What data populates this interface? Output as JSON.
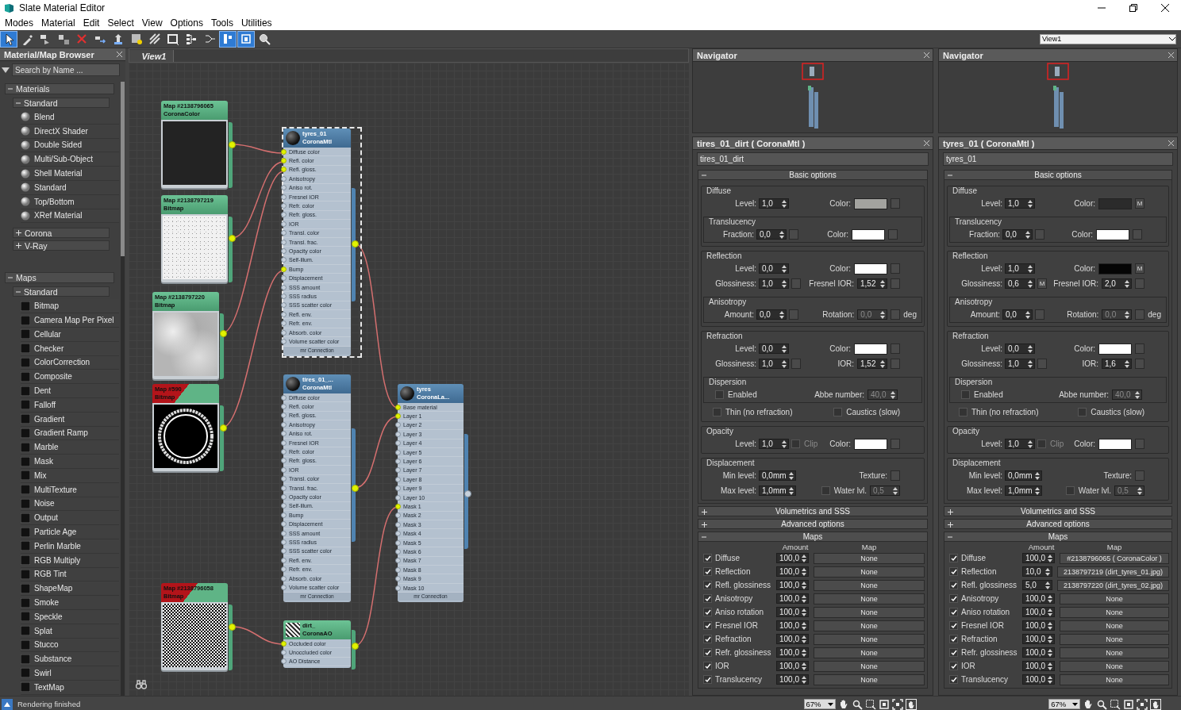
{
  "window": {
    "title": "Slate Material Editor"
  },
  "menu": [
    "Modes",
    "Material",
    "Edit",
    "Select",
    "View",
    "Options",
    "Tools",
    "Utilities"
  ],
  "toolbar": [
    {
      "kind": "pointer",
      "selected": true
    },
    {
      "kind": "eyedropper",
      "selected": false
    },
    {
      "kind": "put-to-scene",
      "selected": false
    },
    {
      "kind": "assign",
      "selected": false
    },
    {
      "kind": "delete",
      "selected": false
    },
    {
      "kind": "move-children",
      "selected": false
    },
    {
      "kind": "pick-up",
      "selected": false
    },
    {
      "kind": "show-map",
      "selected": false
    },
    {
      "kind": "background-pattern",
      "selected": false
    },
    {
      "kind": "preview",
      "selected": false
    },
    {
      "kind": "layout",
      "selected": false
    },
    {
      "kind": "layout-children",
      "selected": false
    },
    {
      "kind": "params",
      "selected": true
    },
    {
      "kind": "navigator",
      "selected": true
    },
    {
      "kind": "zoom",
      "selected": false
    }
  ],
  "view_selector": {
    "value": "View1"
  },
  "browser": {
    "title": "Material/Map Browser",
    "search": {
      "placeholder": "Search by Name ..."
    },
    "groups": [
      {
        "label": "Materials",
        "expanded": true,
        "children": [
          {
            "label": "Standard",
            "expanded": true,
            "kind": "material",
            "items": [
              "Blend",
              "DirectX Shader",
              "Double Sided",
              "Multi/Sub-Object",
              "Shell Material",
              "Standard",
              "Top/Bottom",
              "XRef Material"
            ]
          },
          {
            "label": "Corona",
            "expanded": false
          },
          {
            "label": "V-Ray",
            "expanded": false
          }
        ]
      },
      {
        "label": "Maps",
        "expanded": true,
        "children": [
          {
            "label": "Standard",
            "expanded": true,
            "kind": "map",
            "items": [
              "Bitmap",
              "Camera Map Per Pixel",
              "Cellular",
              "Checker",
              "ColorCorrection",
              "Composite",
              "Dent",
              "Falloff",
              "Gradient",
              "Gradient Ramp",
              "Marble",
              "Mask",
              "Mix",
              "MultiTexture",
              "Noise",
              "Output",
              "Particle Age",
              "Perlin Marble",
              "RGB Multiply",
              "RGB Tint",
              "ShapeMap",
              "Smoke",
              "Speckle",
              "Splat",
              "Stucco",
              "Substance",
              "Swirl",
              "TextMap"
            ]
          }
        ]
      }
    ]
  },
  "view": {
    "tab": "View1",
    "nodes": [
      {
        "kind": "map",
        "title": "Map #2138796065",
        "subtitle": "CoronaColor",
        "warning": false,
        "output_connected": true,
        "preview": {
          "kind": "dark"
        }
      },
      {
        "kind": "map",
        "title": "Map #2138797219",
        "subtitle": "Bitmap",
        "warning": false,
        "output_connected": true,
        "preview": {
          "kind": "light-grain"
        }
      },
      {
        "kind": "map",
        "title": "Map #2138797220",
        "subtitle": "Bitmap",
        "warning": false,
        "output_connected": true,
        "preview": {
          "kind": "grey-cloud"
        }
      },
      {
        "kind": "map",
        "title": "Map #590",
        "subtitle": "Bitmap",
        "warning": true,
        "output_connected": true,
        "preview": {
          "kind": "tire-ring"
        }
      },
      {
        "kind": "map",
        "title": "Map #2138796058",
        "subtitle": "Bitmap",
        "warning": true,
        "output_connected": true,
        "preview": {
          "kind": "bw-noise"
        }
      },
      {
        "kind": "material",
        "title": "tyres_01",
        "subtitle": "CoronaMtl",
        "selected": true,
        "output_connected": true,
        "footer": "mr Connection",
        "slots": [
          {
            "label": "Diffuse color",
            "connected": true
          },
          {
            "label": "Refl. color",
            "connected": true
          },
          {
            "label": "Refl. gloss.",
            "connected": true
          },
          {
            "label": "Anisotropy",
            "connected": false
          },
          {
            "label": "Aniso rot.",
            "connected": false
          },
          {
            "label": "Fresnel IOR",
            "connected": false
          },
          {
            "label": "Refr. color",
            "connected": false
          },
          {
            "label": "Refr. gloss.",
            "connected": false
          },
          {
            "label": "IOR",
            "connected": false
          },
          {
            "label": "Transl. color",
            "connected": false
          },
          {
            "label": "Transl. frac.",
            "connected": false
          },
          {
            "label": "Opacity color",
            "connected": false
          },
          {
            "label": "Self-illum.",
            "connected": false
          },
          {
            "label": "Bump",
            "connected": true
          },
          {
            "label": "Displacement",
            "connected": false
          },
          {
            "label": "SSS amount",
            "connected": false
          },
          {
            "label": "SSS radius",
            "connected": false
          },
          {
            "label": "SSS scatter color",
            "connected": false
          },
          {
            "label": "Refl. env.",
            "connected": false
          },
          {
            "label": "Refr. env.",
            "connected": false
          },
          {
            "label": "Absorb. color",
            "connected": false
          },
          {
            "label": "Volume scatter color",
            "connected": false
          }
        ]
      },
      {
        "kind": "material",
        "title": "tires_01_...",
        "subtitle": "CoronaMtl",
        "selected": false,
        "output_connected": true,
        "footer": "mr Connection",
        "slots": [
          {
            "label": "Diffuse color",
            "connected": false
          },
          {
            "label": "Refl. color",
            "connected": false
          },
          {
            "label": "Refl. gloss.",
            "connected": false
          },
          {
            "label": "Anisotropy",
            "connected": false
          },
          {
            "label": "Aniso rot.",
            "connected": false
          },
          {
            "label": "Fresnel IOR",
            "connected": false
          },
          {
            "label": "Refr. color",
            "connected": false
          },
          {
            "label": "Refr. gloss.",
            "connected": false
          },
          {
            "label": "IOR",
            "connected": false
          },
          {
            "label": "Transl. color",
            "connected": false
          },
          {
            "label": "Transl. frac.",
            "connected": false
          },
          {
            "label": "Opacity color",
            "connected": false
          },
          {
            "label": "Self-illum.",
            "connected": false
          },
          {
            "label": "Bump",
            "connected": false
          },
          {
            "label": "Displacement",
            "connected": false
          },
          {
            "label": "SSS amount",
            "connected": false
          },
          {
            "label": "SSS radius",
            "connected": false
          },
          {
            "label": "SSS scatter color",
            "connected": false
          },
          {
            "label": "Refl. env.",
            "connected": false
          },
          {
            "label": "Refr. env.",
            "connected": false
          },
          {
            "label": "Absorb. color",
            "connected": false
          },
          {
            "label": "Volume scatter color",
            "connected": false
          }
        ]
      },
      {
        "kind": "material",
        "title": "tyres",
        "subtitle": "CoronaLa...",
        "selected": false,
        "output_connected": false,
        "footer": "mr Connection",
        "slots": [
          {
            "label": "Base material",
            "connected": true
          },
          {
            "label": "Layer 1",
            "connected": true
          },
          {
            "label": "Layer 2",
            "connected": false
          },
          {
            "label": "Layer 3",
            "connected": false
          },
          {
            "label": "Layer 4",
            "connected": false
          },
          {
            "label": "Layer 5",
            "connected": false
          },
          {
            "label": "Layer 6",
            "connected": false
          },
          {
            "label": "Layer 7",
            "connected": false
          },
          {
            "label": "Layer 8",
            "connected": false
          },
          {
            "label": "Layer 9",
            "connected": false
          },
          {
            "label": "Layer 10",
            "connected": false
          },
          {
            "label": "Mask 1",
            "connected": true
          },
          {
            "label": "Mask 2",
            "connected": false
          },
          {
            "label": "Mask 3",
            "connected": false
          },
          {
            "label": "Mask 4",
            "connected": false
          },
          {
            "label": "Mask 5",
            "connected": false
          },
          {
            "label": "Mask 6",
            "connected": false
          },
          {
            "label": "Mask 7",
            "connected": false
          },
          {
            "label": "Mask 8",
            "connected": false
          },
          {
            "label": "Mask 9",
            "connected": false
          },
          {
            "label": "Mask 10",
            "connected": false
          }
        ]
      },
      {
        "kind": "ao-map",
        "title": "dirt_",
        "subtitle": "CoronaAO",
        "selected": false,
        "output_connected": true,
        "slots": [
          {
            "label": "Occluded color",
            "connected": true
          },
          {
            "label": "Unoccluded color",
            "connected": false
          },
          {
            "label": "AO Distance",
            "connected": false
          }
        ]
      }
    ]
  },
  "panels": [
    {
      "navigator": {
        "title": "Navigator"
      },
      "title": "tires_01_dirt  ( CoronaMtl )",
      "name": "tires_01_dirt",
      "rollouts": [
        {
          "kind": "params",
          "title": "Basic options",
          "expanded": true,
          "groups": [
            {
              "label": "Diffuse",
              "content": [
                {
                  "kind": "row",
                  "left": [
                    {
                      "kind": "spinner",
                      "label": "Level:",
                      "value": "1,0",
                      "disabled": false
                    }
                  ],
                  "right": [
                    {
                      "kind": "color",
                      "label": "Color:",
                      "color": "#a3a39f",
                      "map_button": true
                    }
                  ]
                },
                {
                  "kind": "subgroup",
                  "label": "Translucency",
                  "rows": [
                    {
                      "left": [
                        {
                          "kind": "spinner",
                          "label": "Fraction:",
                          "value": "0,0",
                          "disabled": false,
                          "map_button": true
                        }
                      ],
                      "right": [
                        {
                          "kind": "color",
                          "label": "Color:",
                          "color": "#ffffff",
                          "map_button": true
                        }
                      ]
                    }
                  ]
                }
              ]
            },
            {
              "label": "Reflection",
              "content": [
                {
                  "kind": "row",
                  "left": [
                    {
                      "kind": "spinner",
                      "label": "Level:",
                      "value": "0,0",
                      "disabled": false
                    }
                  ],
                  "right": [
                    {
                      "kind": "color",
                      "label": "Color:",
                      "color": "#ffffff",
                      "map_button": true
                    }
                  ]
                },
                {
                  "kind": "row",
                  "left": [
                    {
                      "kind": "spinner",
                      "label": "Glossiness:",
                      "value": "1,0",
                      "disabled": false,
                      "map_button": true
                    }
                  ],
                  "right": [
                    {
                      "kind": "spinner",
                      "label": "Fresnel IOR:",
                      "value": "1,52",
                      "disabled": false,
                      "map_button": true
                    }
                  ]
                },
                {
                  "kind": "subgroup",
                  "label": "Anisotropy",
                  "rows": [
                    {
                      "left": [
                        {
                          "kind": "spinner",
                          "label": "Amount:",
                          "value": "0,0",
                          "disabled": false,
                          "map_button": true
                        }
                      ],
                      "right": [
                        {
                          "kind": "spinner",
                          "label": "Rotation:",
                          "value": "0,0",
                          "disabled": true,
                          "map_button": true
                        },
                        {
                          "kind": "unit",
                          "text": "deg"
                        }
                      ]
                    }
                  ]
                }
              ]
            },
            {
              "label": "Refraction",
              "content": [
                {
                  "kind": "row",
                  "left": [
                    {
                      "kind": "spinner",
                      "label": "Level:",
                      "value": "0,0",
                      "disabled": false
                    }
                  ],
                  "right": [
                    {
                      "kind": "color",
                      "label": "Color:",
                      "color": "#ffffff",
                      "map_button": true
                    }
                  ]
                },
                {
                  "kind": "row",
                  "left": [
                    {
                      "kind": "spinner",
                      "label": "Glossiness:",
                      "value": "1,0",
                      "disabled": false,
                      "map_button": true
                    }
                  ],
                  "right": [
                    {
                      "kind": "spinner",
                      "label": "IOR:",
                      "value": "1,52",
                      "disabled": false,
                      "map_button": true
                    }
                  ]
                },
                {
                  "kind": "subgroup",
                  "label": "Dispersion",
                  "rows": [
                    {
                      "left": [
                        {
                          "kind": "checkbox",
                          "label": "Enabled",
                          "checked": false,
                          "disabled": false
                        }
                      ],
                      "right": [
                        {
                          "kind": "spinner",
                          "label": "Abbe number:",
                          "value": "40,0",
                          "disabled": true
                        }
                      ]
                    }
                  ]
                },
                {
                  "kind": "row",
                  "left": [
                    {
                      "kind": "checkbox",
                      "label": "Thin (no refraction)",
                      "checked": false,
                      "disabled": false
                    }
                  ],
                  "right": [
                    {
                      "kind": "checkbox",
                      "label": "Caustics (slow)",
                      "checked": false,
                      "disabled": false
                    }
                  ]
                }
              ]
            },
            {
              "label": "Opacity",
              "content": [
                {
                  "kind": "row",
                  "left": [
                    {
                      "kind": "spinner",
                      "label": "Level:",
                      "value": "1,0",
                      "disabled": false
                    },
                    {
                      "kind": "checkbox",
                      "label": "Clip",
                      "checked": false,
                      "disabled": true
                    }
                  ],
                  "right": [
                    {
                      "kind": "color",
                      "label": "Color:",
                      "color": "#ffffff",
                      "map_button": true
                    }
                  ]
                }
              ]
            },
            {
              "label": "Displacement",
              "content": [
                {
                  "kind": "row",
                  "left": [
                    {
                      "kind": "spinner",
                      "label": "Min level:",
                      "value": "0,0mm",
                      "disabled": false
                    }
                  ],
                  "right": [
                    {
                      "kind": "texture",
                      "label": "Texture:"
                    }
                  ]
                },
                {
                  "kind": "row",
                  "left": [
                    {
                      "kind": "spinner",
                      "label": "Max level:",
                      "value": "1,0mm",
                      "disabled": false
                    }
                  ],
                  "right": [
                    {
                      "kind": "checkbox",
                      "label": "Water lvl.",
                      "checked": false,
                      "disabled": false
                    },
                    {
                      "kind": "spinner",
                      "value": "0,5",
                      "disabled": true
                    }
                  ]
                }
              ]
            }
          ]
        },
        {
          "title": "Volumetrics and SSS",
          "expanded": false
        },
        {
          "title": "Advanced options",
          "expanded": false
        },
        {
          "kind": "maps",
          "title": "Maps",
          "expanded": true,
          "columns": [
            "Amount",
            "Map"
          ],
          "rows": [
            {
              "label": "Diffuse",
              "enabled": true,
              "amount": "100,0",
              "map": "None"
            },
            {
              "label": "Reflection",
              "enabled": true,
              "amount": "100,0",
              "map": "None"
            },
            {
              "label": "Refl. glossiness",
              "enabled": true,
              "amount": "100,0",
              "map": "None"
            },
            {
              "label": "Anisotropy",
              "enabled": true,
              "amount": "100,0",
              "map": "None"
            },
            {
              "label": "Aniso rotation",
              "enabled": true,
              "amount": "100,0",
              "map": "None"
            },
            {
              "label": "Fresnel IOR",
              "enabled": true,
              "amount": "100,0",
              "map": "None"
            },
            {
              "label": "Refraction",
              "enabled": true,
              "amount": "100,0",
              "map": "None"
            },
            {
              "label": "Refr. glossiness",
              "enabled": true,
              "amount": "100,0",
              "map": "None"
            },
            {
              "label": "IOR",
              "enabled": true,
              "amount": "100,0",
              "map": "None"
            },
            {
              "label": "Translucency",
              "enabled": true,
              "amount": "100,0",
              "map": "None"
            }
          ]
        }
      ]
    },
    {
      "navigator": {
        "title": "Navigator"
      },
      "title": "tyres_01  ( CoronaMtl )",
      "name": "tyres_01",
      "rollouts": [
        {
          "kind": "params",
          "title": "Basic options",
          "expanded": true,
          "groups": [
            {
              "label": "Diffuse",
              "content": [
                {
                  "kind": "row",
                  "left": [
                    {
                      "kind": "spinner",
                      "label": "Level:",
                      "value": "1,0",
                      "disabled": false
                    }
                  ],
                  "right": [
                    {
                      "kind": "color",
                      "label": "Color:",
                      "color": "#2b2b2b",
                      "map_button": true,
                      "map_label": "M"
                    }
                  ]
                },
                {
                  "kind": "subgroup",
                  "label": "Translucency",
                  "rows": [
                    {
                      "left": [
                        {
                          "kind": "spinner",
                          "label": "Fraction:",
                          "value": "0,0",
                          "disabled": false,
                          "map_button": true
                        }
                      ],
                      "right": [
                        {
                          "kind": "color",
                          "label": "Color:",
                          "color": "#ffffff",
                          "map_button": true
                        }
                      ]
                    }
                  ]
                }
              ]
            },
            {
              "label": "Reflection",
              "content": [
                {
                  "kind": "row",
                  "left": [
                    {
                      "kind": "spinner",
                      "label": "Level:",
                      "value": "1,0",
                      "disabled": false
                    }
                  ],
                  "right": [
                    {
                      "kind": "color",
                      "label": "Color:",
                      "color": "#050505",
                      "map_button": true,
                      "map_label": "M"
                    }
                  ]
                },
                {
                  "kind": "row",
                  "left": [
                    {
                      "kind": "spinner",
                      "label": "Glossiness:",
                      "value": "0,6",
                      "disabled": false,
                      "map_button": true,
                      "map_label": "M"
                    }
                  ],
                  "right": [
                    {
                      "kind": "spinner",
                      "label": "Fresnel IOR:",
                      "value": "2,0",
                      "disabled": false,
                      "map_button": true
                    }
                  ]
                },
                {
                  "kind": "subgroup",
                  "label": "Anisotropy",
                  "rows": [
                    {
                      "left": [
                        {
                          "kind": "spinner",
                          "label": "Amount:",
                          "value": "0,0",
                          "disabled": false,
                          "map_button": true
                        }
                      ],
                      "right": [
                        {
                          "kind": "spinner",
                          "label": "Rotation:",
                          "value": "0,0",
                          "disabled": true,
                          "map_button": true
                        },
                        {
                          "kind": "unit",
                          "text": "deg"
                        }
                      ]
                    }
                  ]
                }
              ]
            },
            {
              "label": "Refraction",
              "content": [
                {
                  "kind": "row",
                  "left": [
                    {
                      "kind": "spinner",
                      "label": "Level:",
                      "value": "0,0",
                      "disabled": false
                    }
                  ],
                  "right": [
                    {
                      "kind": "color",
                      "label": "Color:",
                      "color": "#ffffff",
                      "map_button": true
                    }
                  ]
                },
                {
                  "kind": "row",
                  "left": [
                    {
                      "kind": "spinner",
                      "label": "Glossiness:",
                      "value": "1,0",
                      "disabled": false,
                      "map_button": true
                    }
                  ],
                  "right": [
                    {
                      "kind": "spinner",
                      "label": "IOR:",
                      "value": "1,6",
                      "disabled": false,
                      "map_button": true
                    }
                  ]
                },
                {
                  "kind": "subgroup",
                  "label": "Dispersion",
                  "rows": [
                    {
                      "left": [
                        {
                          "kind": "checkbox",
                          "label": "Enabled",
                          "checked": false,
                          "disabled": false
                        }
                      ],
                      "right": [
                        {
                          "kind": "spinner",
                          "label": "Abbe number:",
                          "value": "40,0",
                          "disabled": true
                        }
                      ]
                    }
                  ]
                },
                {
                  "kind": "row",
                  "left": [
                    {
                      "kind": "checkbox",
                      "label": "Thin (no refraction)",
                      "checked": false,
                      "disabled": false
                    }
                  ],
                  "right": [
                    {
                      "kind": "checkbox",
                      "label": "Caustics (slow)",
                      "checked": false,
                      "disabled": false
                    }
                  ]
                }
              ]
            },
            {
              "label": "Opacity",
              "content": [
                {
                  "kind": "row",
                  "left": [
                    {
                      "kind": "spinner",
                      "label": "Level:",
                      "value": "1,0",
                      "disabled": false
                    },
                    {
                      "kind": "checkbox",
                      "label": "Clip",
                      "checked": false,
                      "disabled": true
                    }
                  ],
                  "right": [
                    {
                      "kind": "color",
                      "label": "Color:",
                      "color": "#ffffff",
                      "map_button": true
                    }
                  ]
                }
              ]
            },
            {
              "label": "Displacement",
              "content": [
                {
                  "kind": "row",
                  "left": [
                    {
                      "kind": "spinner",
                      "label": "Min level:",
                      "value": "0,0mm",
                      "disabled": false
                    }
                  ],
                  "right": [
                    {
                      "kind": "texture",
                      "label": "Texture:"
                    }
                  ]
                },
                {
                  "kind": "row",
                  "left": [
                    {
                      "kind": "spinner",
                      "label": "Max level:",
                      "value": "1,0mm",
                      "disabled": false
                    }
                  ],
                  "right": [
                    {
                      "kind": "checkbox",
                      "label": "Water lvl.",
                      "checked": false,
                      "disabled": false
                    },
                    {
                      "kind": "spinner",
                      "value": "0,5",
                      "disabled": true
                    }
                  ]
                }
              ]
            }
          ]
        },
        {
          "title": "Volumetrics and SSS",
          "expanded": false
        },
        {
          "title": "Advanced options",
          "expanded": false
        },
        {
          "kind": "maps",
          "title": "Maps",
          "expanded": true,
          "columns": [
            "Amount",
            "Map"
          ],
          "rows": [
            {
              "label": "Diffuse",
              "enabled": true,
              "amount": "100,0",
              "map": "#2138796065  ( CoronaColor )"
            },
            {
              "label": "Reflection",
              "enabled": true,
              "amount": "10,0",
              "map": "2138797219 (dirt_tyres_01.jpg)"
            },
            {
              "label": "Refl. glossiness",
              "enabled": true,
              "amount": "5,0",
              "map": "2138797220 (dirt_tyres_02.jpg)"
            },
            {
              "label": "Anisotropy",
              "enabled": true,
              "amount": "100,0",
              "map": "None"
            },
            {
              "label": "Aniso rotation",
              "enabled": true,
              "amount": "100,0",
              "map": "None"
            },
            {
              "label": "Fresnel IOR",
              "enabled": true,
              "amount": "100,0",
              "map": "None"
            },
            {
              "label": "Refraction",
              "enabled": true,
              "amount": "100,0",
              "map": "None"
            },
            {
              "label": "Refr. glossiness",
              "enabled": true,
              "amount": "100,0",
              "map": "None"
            },
            {
              "label": "IOR",
              "enabled": true,
              "amount": "100,0",
              "map": "None"
            },
            {
              "label": "Translucency",
              "enabled": true,
              "amount": "100,0",
              "map": "None"
            }
          ]
        }
      ]
    }
  ],
  "status_bar": {
    "message": "Rendering finished",
    "zooms": [
      "67%",
      "67%"
    ]
  }
}
